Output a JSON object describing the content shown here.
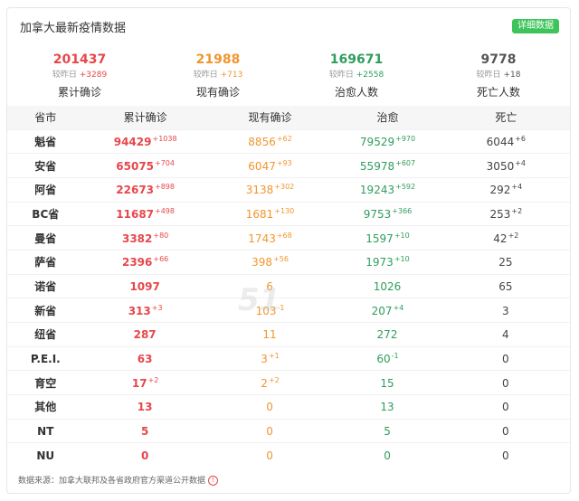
{
  "header": {
    "title": "加拿大最新疫情数据",
    "detail_button": "详细数据"
  },
  "summary": [
    {
      "value": "201437",
      "compare_label": "较昨日",
      "delta": "+3289",
      "label": "累计确诊",
      "color": "red"
    },
    {
      "value": "21988",
      "compare_label": "较昨日",
      "delta": "+713",
      "label": "现有确诊",
      "color": "orange"
    },
    {
      "value": "169671",
      "compare_label": "较昨日",
      "delta": "+2558",
      "label": "治愈人数",
      "color": "green"
    },
    {
      "value": "9778",
      "compare_label": "较昨日",
      "delta": "+18",
      "label": "死亡人数",
      "color": "gray"
    }
  ],
  "table": {
    "headers": [
      "省市",
      "累计确诊",
      "现有确诊",
      "治愈",
      "死亡"
    ],
    "rows": [
      {
        "name": "魁省",
        "confirmed": "94429",
        "confirmed_inc": "+1038",
        "current": "8856",
        "current_inc": "+62",
        "cured": "79529",
        "cured_inc": "+970",
        "dead": "6044",
        "dead_inc": "+6"
      },
      {
        "name": "安省",
        "confirmed": "65075",
        "confirmed_inc": "+704",
        "current": "6047",
        "current_inc": "+93",
        "cured": "55978",
        "cured_inc": "+607",
        "dead": "3050",
        "dead_inc": "+4"
      },
      {
        "name": "阿省",
        "confirmed": "22673",
        "confirmed_inc": "+898",
        "current": "3138",
        "current_inc": "+302",
        "cured": "19243",
        "cured_inc": "+592",
        "dead": "292",
        "dead_inc": "+4"
      },
      {
        "name": "BC省",
        "confirmed": "11687",
        "confirmed_inc": "+498",
        "current": "1681",
        "current_inc": "+130",
        "cured": "9753",
        "cured_inc": "+366",
        "dead": "253",
        "dead_inc": "+2"
      },
      {
        "name": "曼省",
        "confirmed": "3382",
        "confirmed_inc": "+80",
        "current": "1743",
        "current_inc": "+68",
        "cured": "1597",
        "cured_inc": "+10",
        "dead": "42",
        "dead_inc": "+2"
      },
      {
        "name": "萨省",
        "confirmed": "2396",
        "confirmed_inc": "+66",
        "current": "398",
        "current_inc": "+56",
        "cured": "1973",
        "cured_inc": "+10",
        "dead": "25",
        "dead_inc": ""
      },
      {
        "name": "诺省",
        "confirmed": "1097",
        "confirmed_inc": "",
        "current": "6",
        "current_inc": "",
        "cured": "1026",
        "cured_inc": "",
        "dead": "65",
        "dead_inc": ""
      },
      {
        "name": "新省",
        "confirmed": "313",
        "confirmed_inc": "+3",
        "current": "103",
        "current_inc": "-1",
        "cured": "207",
        "cured_inc": "+4",
        "dead": "3",
        "dead_inc": ""
      },
      {
        "name": "纽省",
        "confirmed": "287",
        "confirmed_inc": "",
        "current": "11",
        "current_inc": "",
        "cured": "272",
        "cured_inc": "",
        "dead": "4",
        "dead_inc": ""
      },
      {
        "name": "P.E.I.",
        "confirmed": "63",
        "confirmed_inc": "",
        "current": "3",
        "current_inc": "+1",
        "cured": "60",
        "cured_inc": "-1",
        "dead": "0",
        "dead_inc": ""
      },
      {
        "name": "育空",
        "confirmed": "17",
        "confirmed_inc": "+2",
        "current": "2",
        "current_inc": "+2",
        "cured": "15",
        "cured_inc": "",
        "dead": "0",
        "dead_inc": ""
      },
      {
        "name": "其他",
        "confirmed": "13",
        "confirmed_inc": "",
        "current": "0",
        "current_inc": "",
        "cured": "13",
        "cured_inc": "",
        "dead": "0",
        "dead_inc": ""
      },
      {
        "name": "NT",
        "confirmed": "5",
        "confirmed_inc": "",
        "current": "0",
        "current_inc": "",
        "cured": "5",
        "cured_inc": "",
        "dead": "0",
        "dead_inc": ""
      },
      {
        "name": "NU",
        "confirmed": "0",
        "confirmed_inc": "",
        "current": "0",
        "current_inc": "",
        "cured": "0",
        "cured_inc": "",
        "dead": "0",
        "dead_inc": ""
      }
    ]
  },
  "footer": {
    "source": "数据来源：加拿大联邦及各省政府官方渠道公开数据",
    "icon": "info-icon"
  },
  "watermark": {
    "text": "51"
  },
  "colors": {
    "red": "#e7474b",
    "orange": "#f1962f",
    "green": "#2f9e5d",
    "button": "#3ec45b"
  }
}
